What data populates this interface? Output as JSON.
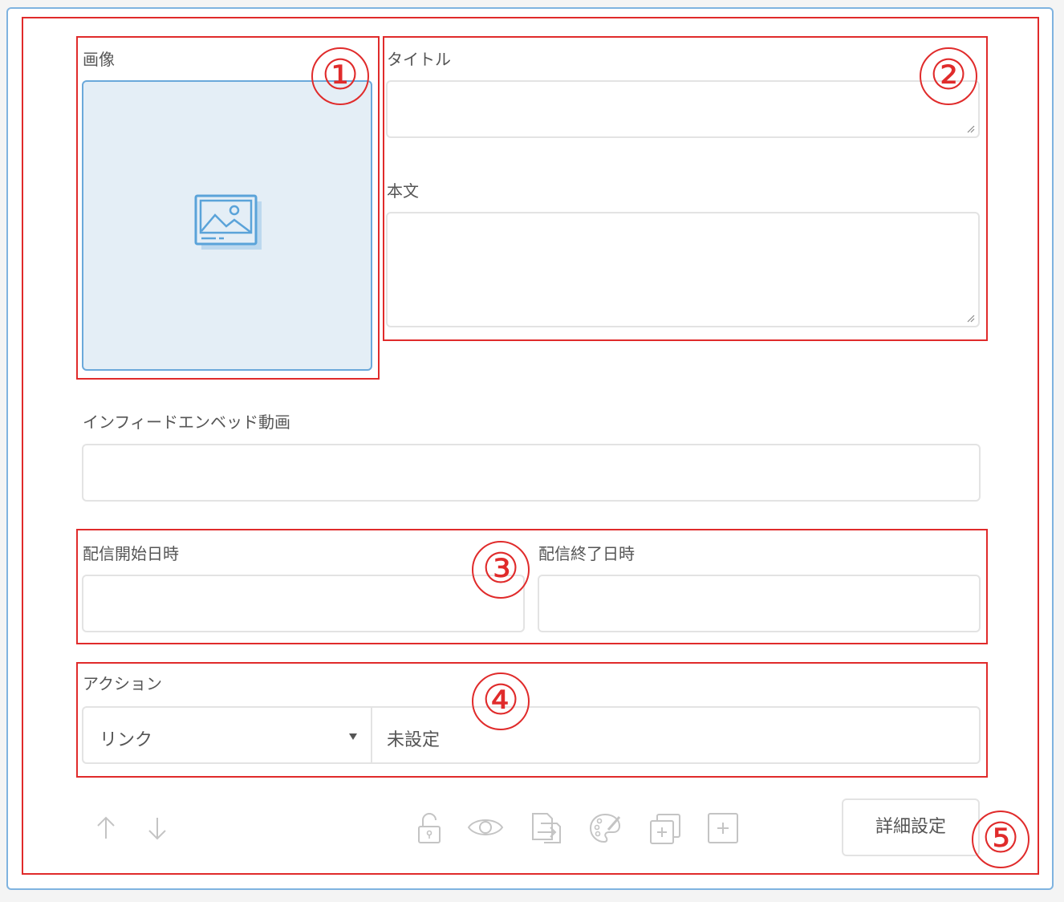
{
  "form": {
    "image_label": "画像",
    "title_label": "タイトル",
    "body_label": "本文",
    "video_label": "インフィードエンベッド動画",
    "start_label": "配信開始日時",
    "end_label": "配信終了日時",
    "action_label": "アクション",
    "action_type": "リンク",
    "action_value": "未設定",
    "detail_button": "詳細設定"
  },
  "annotations": [
    "①",
    "②",
    "③",
    "④",
    "⑤"
  ],
  "colors": {
    "annotation": "#e02b2b",
    "card_border": "#7fb3e0",
    "image_bg": "#e4eef6",
    "icon_blue": "#5aa3d9"
  },
  "icons": [
    "image-placeholder-icon",
    "arrow-up-icon",
    "arrow-down-icon",
    "lock-icon",
    "eye-icon",
    "export-icon",
    "palette-icon",
    "duplicate-icon",
    "add-icon",
    "dropdown-caret-icon"
  ]
}
